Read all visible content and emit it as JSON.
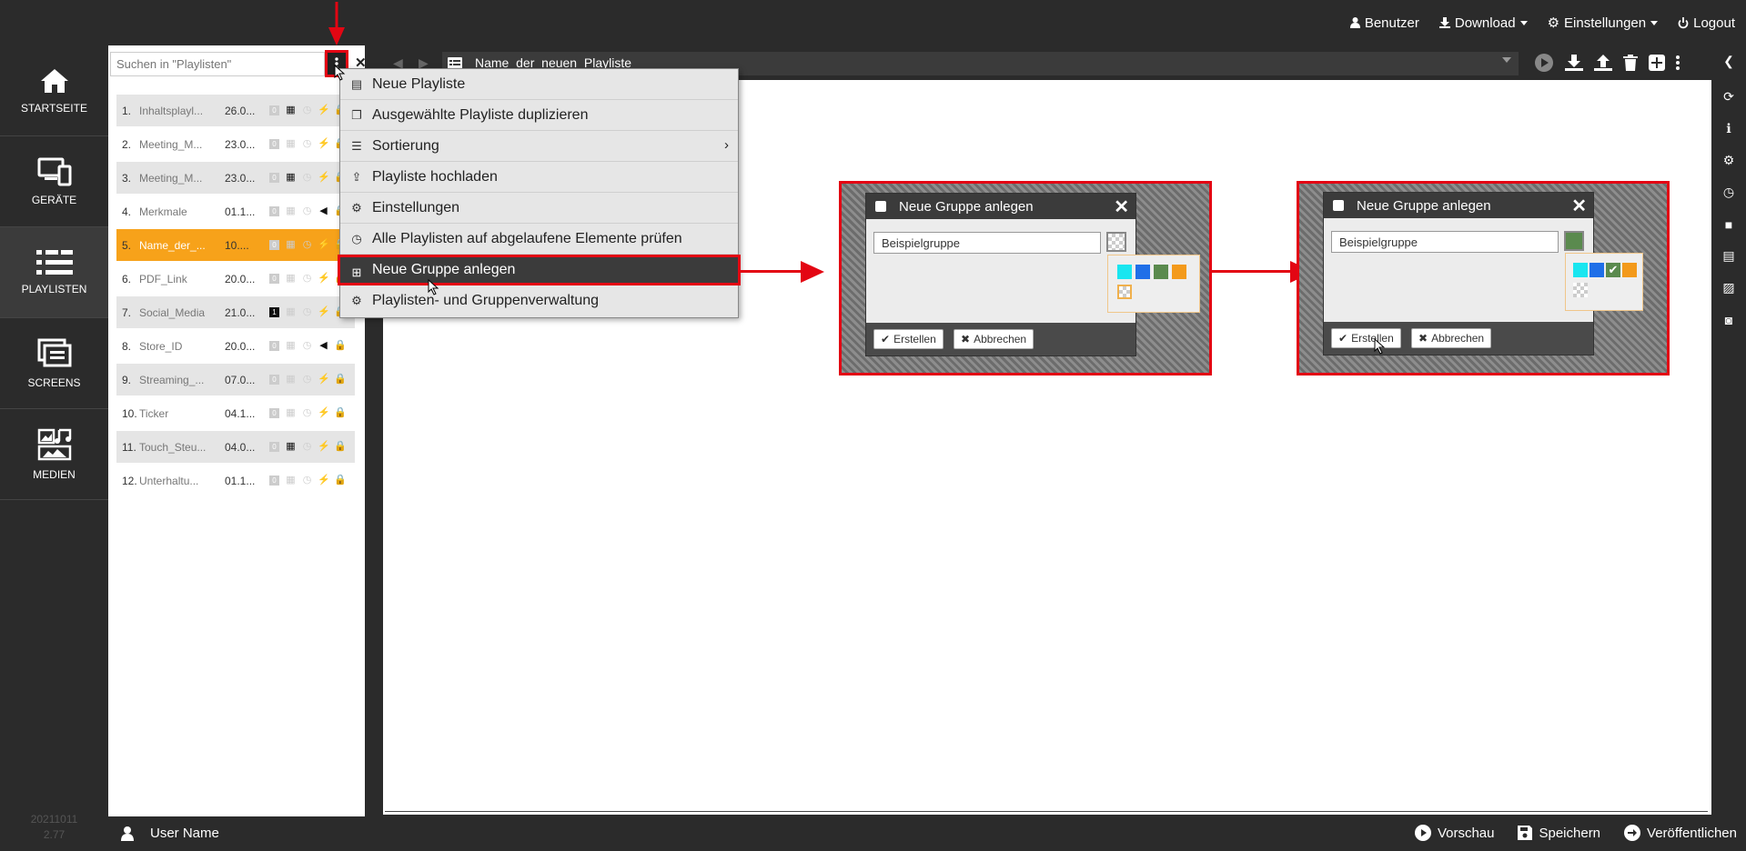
{
  "topnav": {
    "benutzer": "Benutzer",
    "download": "Download",
    "einstellungen": "Einstellungen",
    "logout": "Logout"
  },
  "sidebar": {
    "items": [
      {
        "label": "STARTSEITE",
        "icon": "home-icon"
      },
      {
        "label": "GERÄTE",
        "icon": "devices-icon"
      },
      {
        "label": "PLAYLISTEN",
        "icon": "playlist-icon"
      },
      {
        "label": "SCREENS",
        "icon": "screens-icon"
      },
      {
        "label": "MEDIEN",
        "icon": "media-icon"
      }
    ],
    "version_date": "20211011",
    "version_num": "2.77"
  },
  "search": {
    "placeholder": "Suchen in \"Playlisten\""
  },
  "playlists": [
    {
      "num": "1.",
      "name": "Inhaltsplayl...",
      "date": "26.0...",
      "badge": "0"
    },
    {
      "num": "2.",
      "name": "Meeting_M...",
      "date": "23.0...",
      "badge": "0"
    },
    {
      "num": "3.",
      "name": "Meeting_M...",
      "date": "23.0...",
      "badge": "0"
    },
    {
      "num": "4.",
      "name": "Merkmale",
      "date": "01.1...",
      "badge": "0"
    },
    {
      "num": "5.",
      "name": "Name_der_...",
      "date": "10....",
      "badge": "0"
    },
    {
      "num": "6.",
      "name": "PDF_Link",
      "date": "20.0...",
      "badge": "0"
    },
    {
      "num": "7.",
      "name": "Social_Media",
      "date": "21.0...",
      "badge": "1"
    },
    {
      "num": "8.",
      "name": "Store_ID",
      "date": "20.0...",
      "badge": "0"
    },
    {
      "num": "9.",
      "name": "Streaming_...",
      "date": "07.0...",
      "badge": "0"
    },
    {
      "num": "10.",
      "name": "Ticker",
      "date": "04.1...",
      "badge": "0"
    },
    {
      "num": "11.",
      "name": "Touch_Steu...",
      "date": "04.0...",
      "badge": "0"
    },
    {
      "num": "12.",
      "name": "Unterhaltu...",
      "date": "01.1...",
      "badge": "0"
    }
  ],
  "breadcrumb": {
    "title": "Name_der_neuen_Playliste"
  },
  "menu": {
    "items": [
      "Neue Playliste",
      "Ausgewählte Playliste duplizieren",
      "Sortierung",
      "Playliste hochladen",
      "Einstellungen",
      "Alle Playlisten auf abgelaufene Elemente prüfen",
      "Neue Gruppe anlegen",
      "Playlisten- und Gruppenverwaltung"
    ]
  },
  "dialog": {
    "title": "Neue Gruppe anlegen",
    "input_value": "Beispielgruppe",
    "create": "Erstellen",
    "cancel": "Abbrechen"
  },
  "colors": {
    "accent_orange": "#f7a21a",
    "highlight_red": "#e30613",
    "swatches": [
      "#19e6f0",
      "#1f6fe8",
      "#5a8a4e",
      "#f39a1b"
    ]
  },
  "bottombar": {
    "user": "User Name",
    "preview": "Vorschau",
    "save": "Speichern",
    "publish": "Veröffentlichen"
  }
}
